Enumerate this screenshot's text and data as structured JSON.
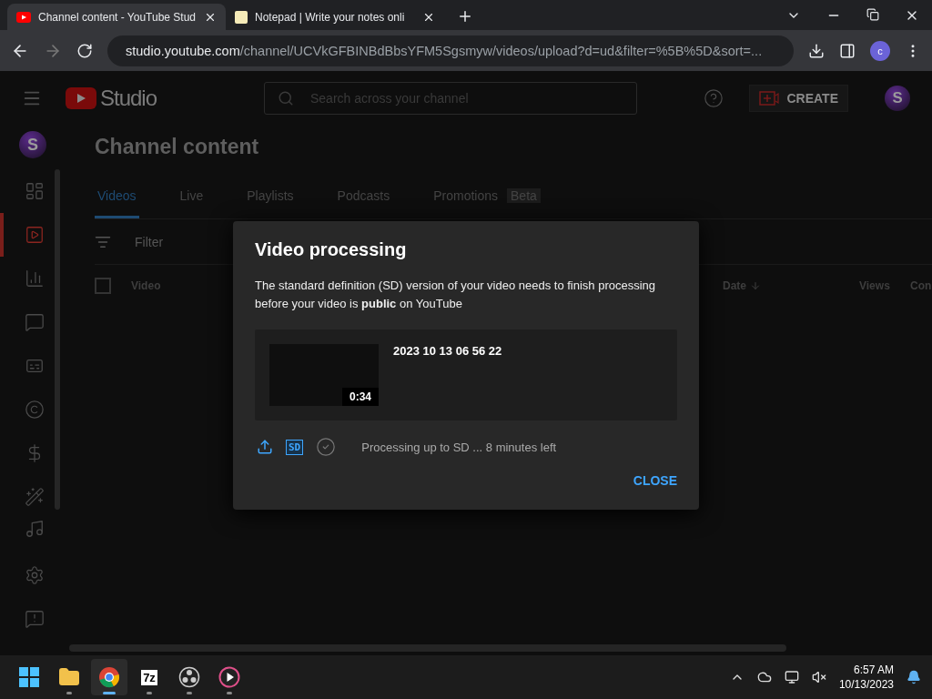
{
  "browser": {
    "tabs": [
      {
        "kind": "youtube",
        "title": "Channel content - YouTube Stud",
        "selected": true
      },
      {
        "kind": "notepad",
        "title": "Notepad | Write your notes onli",
        "selected": false
      }
    ],
    "url": {
      "host": "studio.youtube.com",
      "path": "/channel/UCVkGFBINBdBbsYFM5Sgsmyw/videos/upload?d=ud&filter=%5B%5D&sort=..."
    },
    "profile_letter": "c"
  },
  "studio": {
    "header": {
      "logo_text": "Studio",
      "search_placeholder": "Search across your channel",
      "create_label": "CREATE",
      "avatar_letter": "S"
    },
    "sidebar": {
      "avatar_letter": "S",
      "items": [
        {
          "kind": "dashboard",
          "selected": false
        },
        {
          "kind": "content",
          "selected": true
        },
        {
          "kind": "analytics",
          "selected": false
        },
        {
          "kind": "comments",
          "selected": false
        },
        {
          "kind": "subtitles",
          "selected": false
        },
        {
          "kind": "copyright",
          "selected": false
        },
        {
          "kind": "earn",
          "selected": false
        },
        {
          "kind": "customization",
          "selected": false
        },
        {
          "kind": "audio",
          "selected": false
        }
      ],
      "bottom_items": [
        {
          "kind": "settings"
        },
        {
          "kind": "feedback"
        }
      ]
    },
    "page_title": "Channel content",
    "tabs": [
      {
        "label": "Videos",
        "selected": true
      },
      {
        "label": "Live",
        "selected": false
      },
      {
        "label": "Playlists",
        "selected": false
      },
      {
        "label": "Podcasts",
        "selected": false
      },
      {
        "label": "Promotions",
        "selected": false,
        "badge": "Beta"
      }
    ],
    "filter_placeholder": "Filter",
    "select_all": {
      "checked": false
    },
    "columns": [
      {
        "label": "Video",
        "kind": "video"
      },
      {
        "label": "Date",
        "kind": "sorted"
      },
      {
        "label": "Views",
        "kind": "plain"
      },
      {
        "label": "Con",
        "kind": "plain"
      }
    ]
  },
  "dialog": {
    "title": "Video processing",
    "message": "The standard definition (SD) version of your video needs to finish processing before your video is **public** on YouTube",
    "video": {
      "title": "2023 10 13 06 56 22",
      "duration": "0:34"
    },
    "steps": [
      {
        "kind": "upload",
        "done": true
      },
      {
        "kind": "sd",
        "label": "SD",
        "done": true
      },
      {
        "kind": "check",
        "done": false
      }
    ],
    "status": "Processing up to SD ... 8 minutes left",
    "close_label": "CLOSE"
  },
  "taskbar": {
    "apps": [
      {
        "kind": "start",
        "running": false,
        "selected": false
      },
      {
        "kind": "explorer",
        "running": true,
        "selected": false
      },
      {
        "kind": "chrome",
        "running": true,
        "selected": true
      },
      {
        "kind": "sevenzip",
        "label": "7z",
        "running": true,
        "selected": false
      },
      {
        "kind": "obs",
        "running": true,
        "selected": false
      },
      {
        "kind": "player",
        "running": true,
        "selected": false
      }
    ],
    "tray": [
      {
        "kind": "chevron"
      },
      {
        "kind": "onedrive"
      },
      {
        "kind": "network"
      },
      {
        "kind": "volume"
      }
    ],
    "time": "6:57 AM",
    "date": "10/13/2023"
  }
}
